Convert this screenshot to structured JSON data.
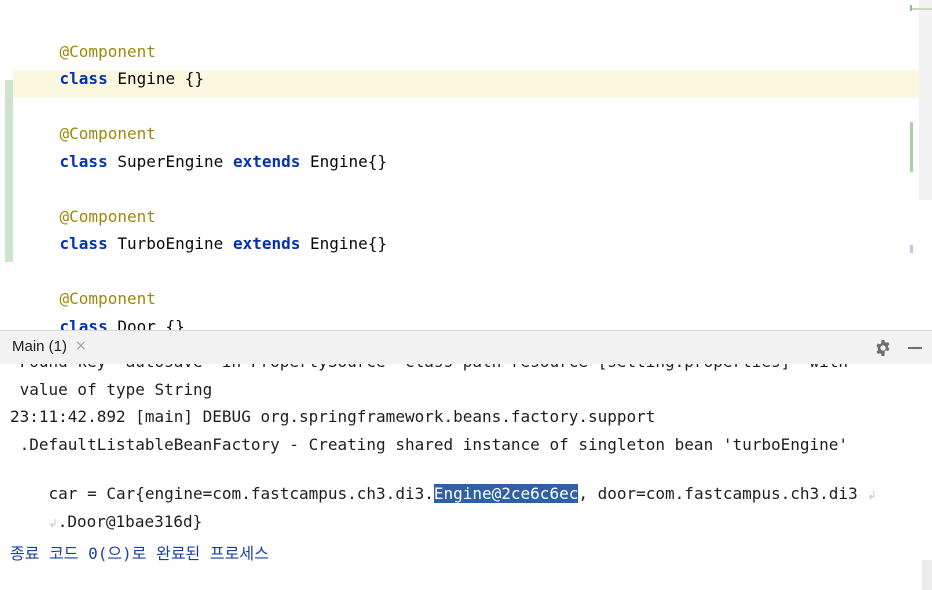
{
  "editor": {
    "lines": [
      {
        "annotation": "@Component"
      },
      {
        "kw": "class",
        "name": " Engine {}"
      },
      {
        "annotation": "@Component"
      },
      {
        "kw": "class",
        "name": " SuperEngine ",
        "kw2": "extends",
        "rest": " Engine{}"
      },
      {
        "annotation": "@Component"
      },
      {
        "kw": "class",
        "name": " TurboEngine ",
        "kw2": "extends",
        "rest": " Engine{}"
      },
      {
        "annotation": "@Component"
      },
      {
        "kw": "class",
        "name": " Door {}"
      }
    ]
  },
  "run_panel": {
    "tab_label": "Main (1)",
    "close_glyph": "×",
    "gear_glyph": "⚙"
  },
  "console": {
    "cut_line": " Found key 'autosave' in PropertySource 'class path resource [setting.properties]' with",
    "line1": " value of type String",
    "line2": "23:11:42.892 [main] DEBUG org.springframework.beans.factory.support",
    "line3": " .DefaultListableBeanFactory - Creating shared instance of singleton bean 'turboEngine'",
    "line4_pre": "car = Car{engine=com.fastcampus.ch3.di3.",
    "line4_sel": "Engine@2ce6c6ec",
    "line4_post": ", door=com.fastcampus.ch3.di3",
    "line5": ".Door@1bae316d}",
    "exit": "종료 코드 0(으)로 완료된 프로세스",
    "wrap_glyph": "↲"
  }
}
